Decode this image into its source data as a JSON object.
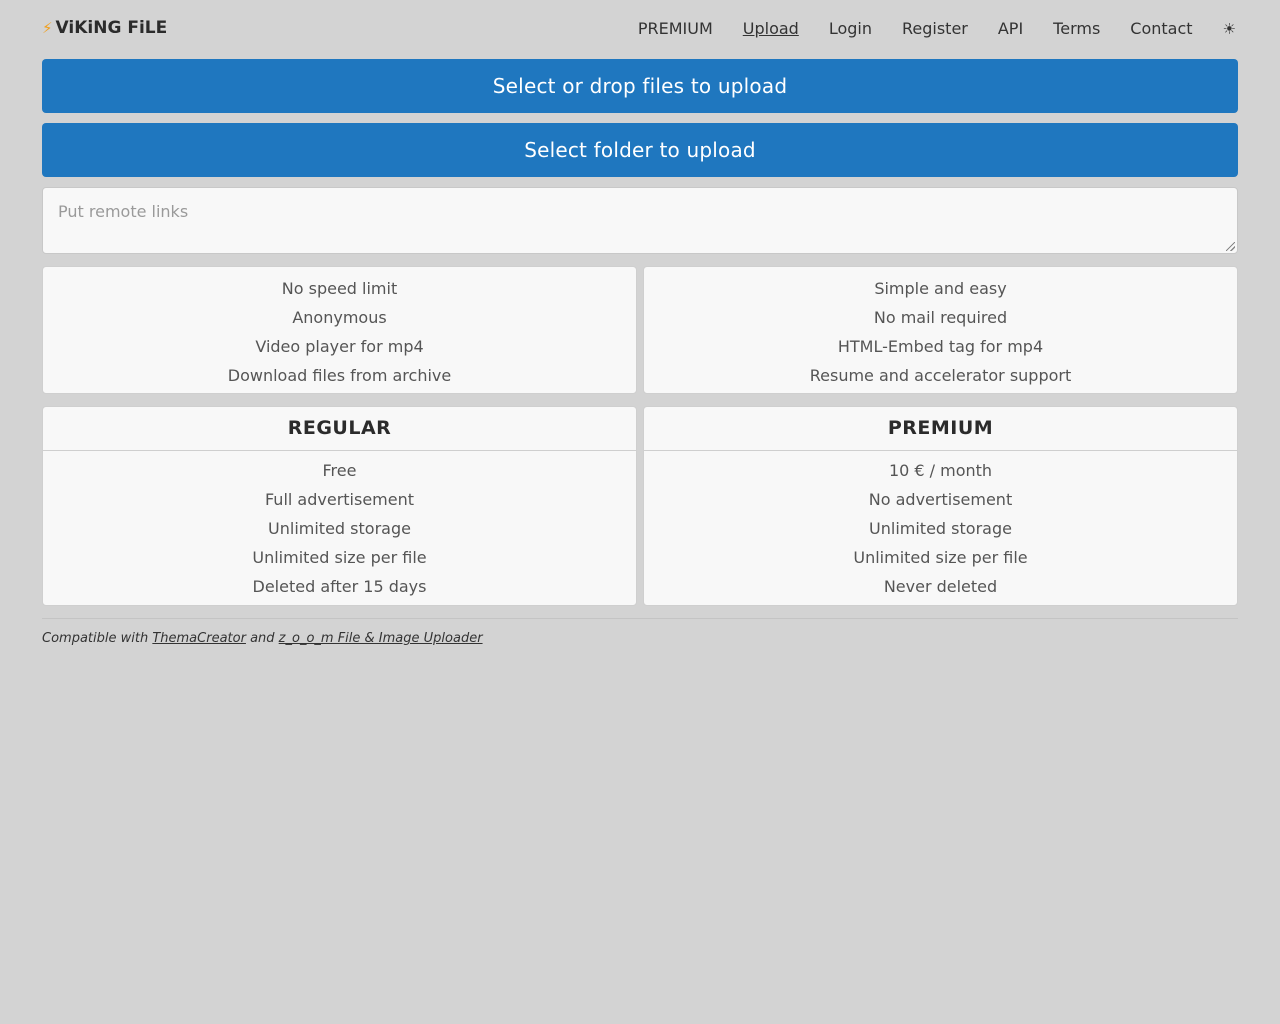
{
  "header": {
    "logo_icon": "lightning-bolt-icon",
    "logo_text": "ViKiNG FiLE",
    "nav": [
      {
        "label": "PREMIUM"
      },
      {
        "label": "Upload"
      },
      {
        "label": "Login"
      },
      {
        "label": "Register"
      },
      {
        "label": "API"
      },
      {
        "label": "Terms"
      },
      {
        "label": "Contact"
      }
    ],
    "theme_toggle": "☀"
  },
  "upload": {
    "files_button": "Select or drop files to upload",
    "folder_button": "Select folder to upload",
    "remote_placeholder": "Put remote links"
  },
  "features": {
    "left": [
      "No speed limit",
      "Anonymous",
      "Video player for mp4",
      "Download files from archive"
    ],
    "right": [
      "Simple and easy",
      "No mail required",
      "HTML-Embed tag for mp4",
      "Resume and accelerator support"
    ]
  },
  "plans": [
    {
      "title": "REGULAR",
      "items": [
        "Free",
        "Full advertisement",
        "Unlimited storage",
        "Unlimited size per file",
        "Deleted after 15 days"
      ]
    },
    {
      "title": "PREMIUM",
      "items": [
        "10 € / month",
        "No advertisement",
        "Unlimited storage",
        "Unlimited size per file",
        "Never deleted"
      ]
    }
  ],
  "footer": {
    "prefix": "Compatible with ",
    "link1": "ThemaCreator",
    "middle": " and ",
    "link2": "z_o_o_m File & Image Uploader"
  },
  "colors": {
    "accent": "#1f77bf",
    "background": "#d3d3d3",
    "card": "#f8f8f8",
    "logo_bolt": "#f0a020"
  }
}
